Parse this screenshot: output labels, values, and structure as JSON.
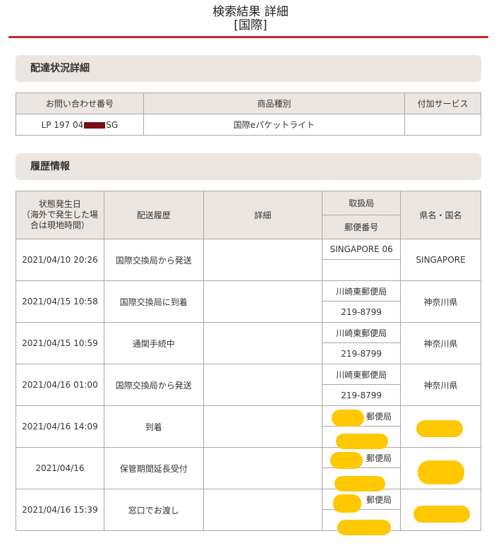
{
  "page": {
    "title_line1": "検索結果 詳細",
    "title_line2": "[国際]",
    "accent_color": "#c9262b"
  },
  "delivery": {
    "section_title": "配達状況詳細",
    "headers": [
      "お問い合わせ番号",
      "商品種別",
      "付加サービス"
    ],
    "tracking_prefix": "LP 197 04",
    "tracking_suffix": "SG",
    "product_type": "国際eパケットライト",
    "additional_service": ""
  },
  "history": {
    "section_title": "履歴情報",
    "headers": {
      "date": "状態発生日\n（海外で発生した場\n合は現地時間）",
      "status": "配送履歴",
      "detail": "詳細",
      "office": "取扱局",
      "postal": "郵便番号",
      "region": "県名・国名"
    },
    "rows": [
      {
        "date": "2021/04/10 20:26",
        "status": "国際交換局から発送",
        "detail": "",
        "office": "SINGAPORE 06",
        "postal": "",
        "region": "SINGAPORE"
      },
      {
        "date": "2021/04/15 10:58",
        "status": "国際交換局に到着",
        "detail": "",
        "office": "川崎東郵便局",
        "postal": "219-8799",
        "region": "神奈川県"
      },
      {
        "date": "2021/04/15 10:59",
        "status": "通関手続中",
        "detail": "",
        "office": "川崎東郵便局",
        "postal": "219-8799",
        "region": "神奈川県"
      },
      {
        "date": "2021/04/16 01:00",
        "status": "国際交換局から発送",
        "detail": "",
        "office": "川崎東郵便局",
        "postal": "219-8799",
        "region": "神奈川県"
      },
      {
        "date": "2021/04/16 14:09",
        "status": "到着",
        "detail": "",
        "office": "郵便局",
        "postal": "",
        "region": ""
      },
      {
        "date": "2021/04/16",
        "status": "保管期間延長受付",
        "detail": "",
        "office": "郵便局",
        "postal": "",
        "region": ""
      },
      {
        "date": "2021/04/16 15:39",
        "status": "窓口でお渡し",
        "detail": "",
        "office": "郵便局",
        "postal": "",
        "region": ""
      }
    ]
  }
}
